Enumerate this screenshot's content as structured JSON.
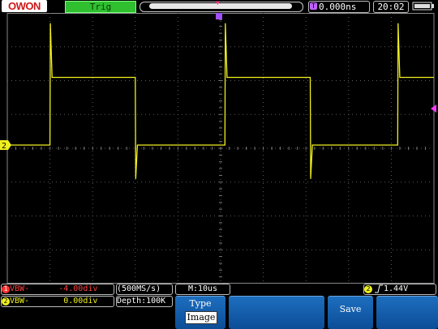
{
  "header": {
    "logo": "OWON",
    "trigger_status": "Trig",
    "horizontal_position": "0.000ns",
    "clock": "20:02"
  },
  "channels": [
    {
      "number": "1",
      "coupling": "VBW-",
      "offset": "-4.00div",
      "color": "#ff3030"
    },
    {
      "number": "2",
      "coupling": "VBW-",
      "offset": " 0.00div",
      "color": "#f0f020"
    }
  ],
  "acquisition": {
    "sample_rate": "(500MS/s)",
    "depth": "Depth:100K",
    "timebase": "M:10us"
  },
  "trigger": {
    "source": "2",
    "edge_icon": "rising-edge-icon",
    "level": "1.44V"
  },
  "menu": {
    "type_label": "Type",
    "type_value": "Image",
    "save_label": "Save"
  },
  "colors": {
    "trace": "#f0f020",
    "grid": "#5a5a5a",
    "menu": "#1a63b5",
    "trigger_marker": "#ff3b8d"
  },
  "chart_data": {
    "type": "line",
    "title": "",
    "xlabel": "",
    "ylabel": "",
    "x_divisions": 10,
    "y_divisions": 8,
    "series": [
      {
        "x": [
          0,
          1.0,
          1.01,
          1.05,
          3.0,
          3.01,
          3.05,
          5.1,
          5.11,
          5.15,
          7.1,
          7.11,
          7.15,
          9.15,
          9.16,
          9.2,
          10
        ],
        "y": [
          0,
          0,
          3.6,
          2.0,
          2.0,
          -1.0,
          0,
          0,
          3.6,
          2.0,
          2.0,
          -1.0,
          0,
          0,
          3.6,
          2.0,
          2.0
        ]
      }
    ]
  }
}
